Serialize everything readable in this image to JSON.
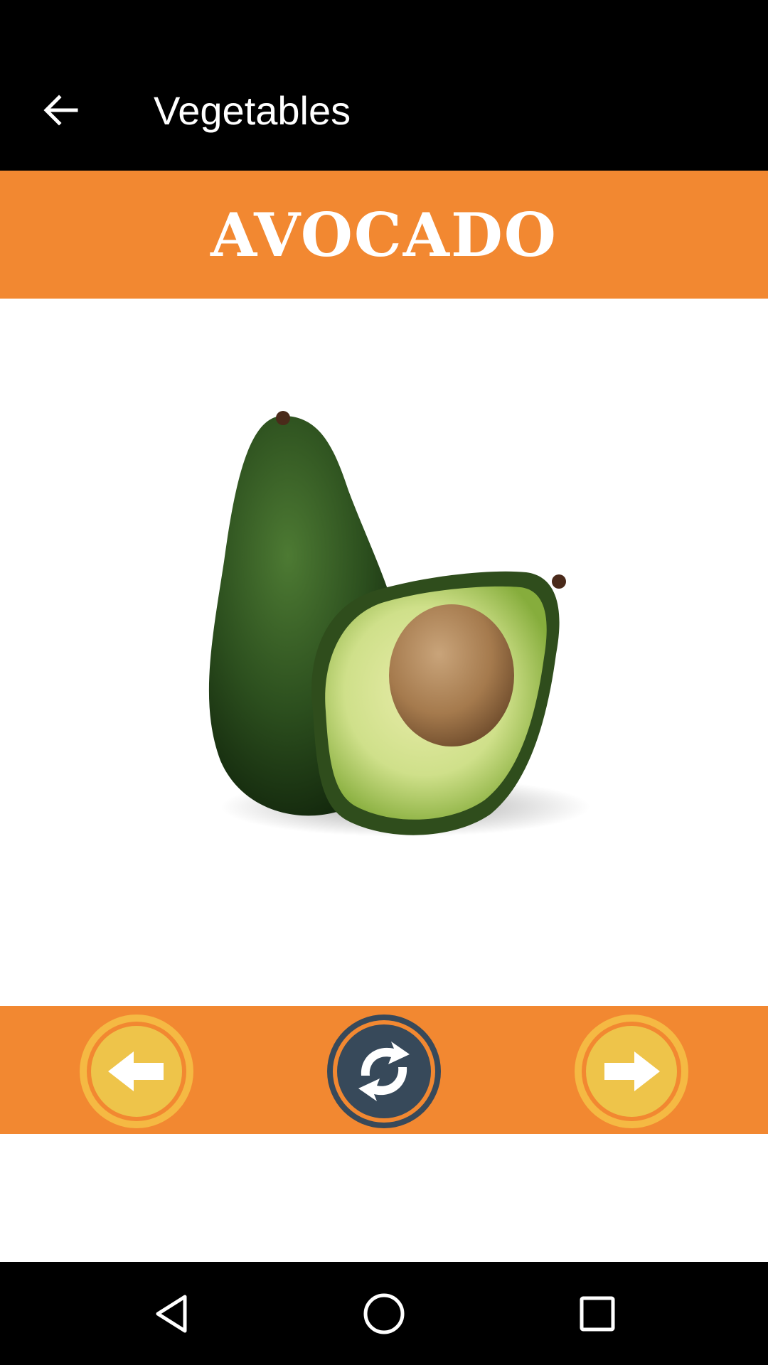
{
  "app_bar": {
    "title": "Vegetables"
  },
  "item": {
    "name": "AVOCADO",
    "image_subject": "avocado"
  },
  "colors": {
    "banner": "#f28831",
    "nav_button_fill": "#eec44a",
    "reload_button_fill": "#37495a",
    "bars": "#000000"
  },
  "controls": {
    "previous_icon": "arrow-left-icon",
    "reload_icon": "refresh-icon",
    "next_icon": "arrow-right-icon"
  },
  "system_nav": {
    "back_icon": "triangle-back-icon",
    "home_icon": "circle-home-icon",
    "recents_icon": "square-recents-icon"
  }
}
